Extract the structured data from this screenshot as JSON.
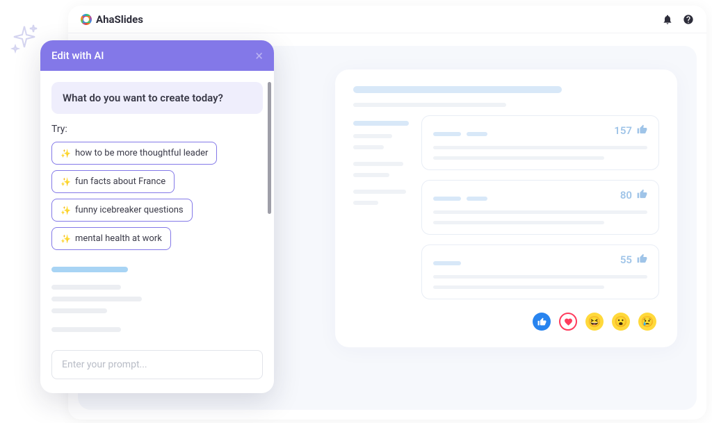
{
  "brand": {
    "name": "AhaSlides"
  },
  "ai_panel": {
    "header_title": "Edit with AI",
    "prompt_heading": "What do you want to create today?",
    "try_label": "Try:",
    "suggestions": [
      "how to be more thoughtful leader",
      "fun facts about France",
      "funny icebreaker questions",
      "mental health at work"
    ],
    "input_placeholder": "Enter your prompt..."
  },
  "preview": {
    "ranks": [
      {
        "count": "157"
      },
      {
        "count": "80"
      },
      {
        "count": "55"
      }
    ]
  },
  "reactions": [
    "like",
    "love",
    "haha",
    "wow",
    "sad"
  ]
}
